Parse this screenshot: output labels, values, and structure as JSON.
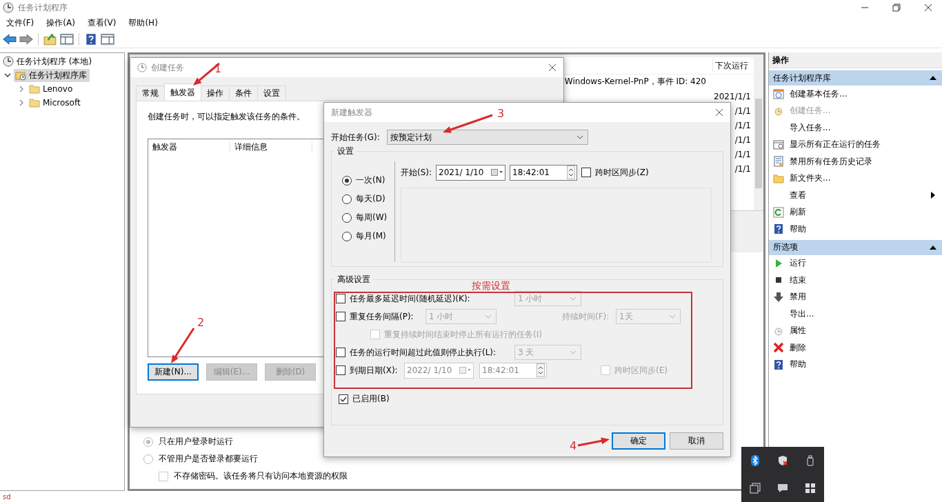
{
  "window": {
    "title": "任务计划程序"
  },
  "menu": [
    "文件(F)",
    "操作(A)",
    "查看(V)",
    "帮助(H)"
  ],
  "tree": [
    {
      "label": "任务计划程序 (本地)",
      "selected": false,
      "children": [
        {
          "label": "任务计划程序库",
          "selected": true,
          "expanded": true,
          "children": [
            {
              "label": "Lenovo",
              "selected": false,
              "expanded": false
            },
            {
              "label": "Microsoft",
              "selected": false,
              "expanded": false
            }
          ]
        }
      ]
    }
  ],
  "task_list": {
    "header": "下次运行",
    "rows": [
      {
        "trigger": "Windows-Kernel-PnP，事件 ID: 420"
      },
      {
        "next_run": "2021/1/1"
      },
      {
        "next_run": "/1/1"
      },
      {
        "next_run": "/1/1"
      },
      {
        "next_run": "/1/1"
      },
      {
        "next_run": "/1/1"
      },
      {
        "next_run": "/1/1"
      }
    ]
  },
  "general": {
    "logon_options": [
      {
        "label": "只在用户登录时运行",
        "selected": true
      },
      {
        "label": "不管用户是否登录都要运行",
        "selected": false
      }
    ],
    "no_password": {
      "label": "不存储密码。该任务将只有访问本地资源的权限",
      "checked": false
    }
  },
  "create_task": {
    "title": "创建任务",
    "tabs": [
      {
        "label": "常规",
        "selected": false
      },
      {
        "label": "触发器",
        "selected": true
      },
      {
        "label": "操作",
        "selected": false
      },
      {
        "label": "条件",
        "selected": false
      },
      {
        "label": "设置",
        "selected": false
      }
    ],
    "description": "创建任务时，可以指定触发该任务的条件。",
    "columns": [
      "触发器",
      "详细信息"
    ],
    "buttons": [
      {
        "label": "新建(N)...",
        "focused": true,
        "disabled": false
      },
      {
        "label": "编辑(E)...",
        "focused": false,
        "disabled": true
      },
      {
        "label": "删除(D)",
        "focused": false,
        "disabled": true
      }
    ]
  },
  "new_trigger": {
    "title": "新建触发器",
    "begin_label": "开始任务(G):",
    "begin_value": "按预定计划",
    "settings_title": "设置",
    "schedules": [
      {
        "label": "一次(N)",
        "selected": true
      },
      {
        "label": "每天(D)",
        "selected": false
      },
      {
        "label": "每周(W)",
        "selected": false
      },
      {
        "label": "每月(M)",
        "selected": false
      }
    ],
    "start_label": "开始(S):",
    "start_date": "2021/ 1/10",
    "start_time": "18:42:01",
    "sync": {
      "label": "跨时区同步(Z)",
      "checked": false
    },
    "advanced_title": "高级设置",
    "delay": {
      "label": "任务最多延迟时间(随机延迟)(K):",
      "checked": false,
      "value": "1 小时"
    },
    "repeat": {
      "label": "重复任务间隔(P):",
      "checked": false,
      "value": "1 小时",
      "duration_label": "持续时间(F):",
      "duration_value": "1天"
    },
    "stop_repeat": {
      "label": "重复持续时间结束时停止所有运行的任务(I)",
      "checked": false
    },
    "timeout": {
      "label": "任务的运行时间超过此值则停止执行(L):",
      "checked": false,
      "value": "3 天"
    },
    "expire": {
      "label": "到期日期(X):",
      "checked": false,
      "date": "2022/ 1/10",
      "time": "18:42:01",
      "sync_label": "跨时区同步(E)",
      "sync_checked": false
    },
    "enabled": {
      "label": "已启用(B)",
      "checked": true
    },
    "buttons": [
      {
        "label": "确定",
        "focused": true
      },
      {
        "label": "取消",
        "focused": false
      }
    ]
  },
  "actions": {
    "title": "操作",
    "sections": [
      {
        "title": "任务计划程序库",
        "expanded": true,
        "items": [
          {
            "label": "创建基本任务...",
            "kind": "basic",
            "disabled": false
          },
          {
            "label": "创建任务...",
            "kind": "create",
            "disabled": true
          },
          {
            "label": "导入任务...",
            "kind": "plain",
            "disabled": false
          },
          {
            "label": "显示所有正在运行的任务",
            "kind": "running",
            "disabled": false
          },
          {
            "label": "禁用所有任务历史记录",
            "kind": "history",
            "disabled": false
          },
          {
            "label": "新文件夹...",
            "kind": "folder",
            "disabled": false
          },
          {
            "label": "查看",
            "kind": "submenu",
            "disabled": false
          },
          {
            "label": "刷新",
            "kind": "refresh",
            "disabled": false
          },
          {
            "label": "帮助",
            "kind": "help",
            "disabled": false
          }
        ]
      },
      {
        "title": "所选项",
        "expanded": true,
        "items": [
          {
            "label": "运行",
            "kind": "run",
            "disabled": false
          },
          {
            "label": "结束",
            "kind": "stop",
            "disabled": false
          },
          {
            "label": "禁用",
            "kind": "disable",
            "disabled": false
          },
          {
            "label": "导出...",
            "kind": "plain",
            "disabled": false
          },
          {
            "label": "属性",
            "kind": "properties",
            "disabled": false
          },
          {
            "label": "删除",
            "kind": "delete",
            "disabled": false
          },
          {
            "label": "帮助",
            "kind": "help",
            "disabled": false
          }
        ]
      }
    ]
  },
  "annotations": {
    "steps": [
      "1",
      "2",
      "3",
      "4"
    ],
    "note": "按需设置"
  },
  "status_bar": {
    "text": "sd"
  }
}
